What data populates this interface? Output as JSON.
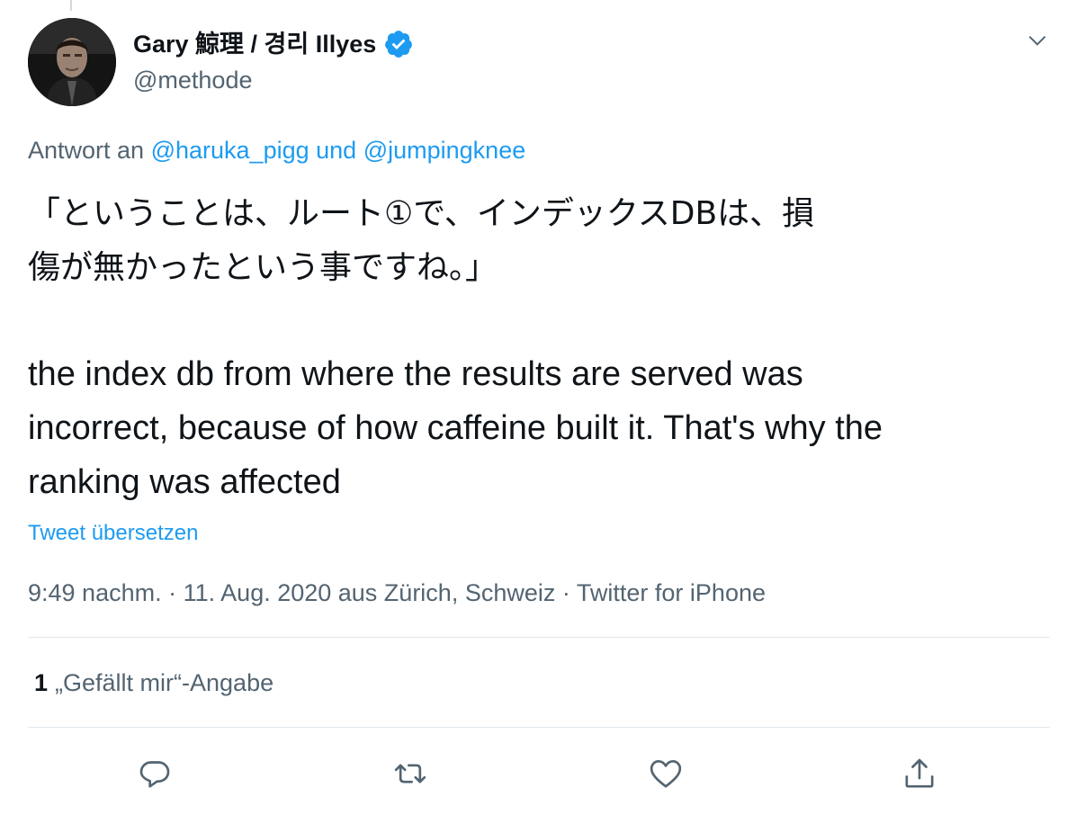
{
  "author": {
    "name": "Gary 鯨理 / 경리 Illyes",
    "handle": "@methode",
    "verified": true
  },
  "reply_to": {
    "prefix": "Antwort an",
    "user1": "@haruka_pigg",
    "joiner": "und",
    "user2": "@jumpingknee"
  },
  "tweet": {
    "text_jp_line1": "「ということは、ルート①で、インデックスDBは、損",
    "text_jp_line2": "傷が無かったという事ですね。」",
    "text_en_line1": "the index db from where the results are served was",
    "text_en_line2": "incorrect, because of how caffeine built it. That's why the",
    "text_en_line3": "ranking was affected",
    "translate_label": "Tweet übersetzen"
  },
  "meta": {
    "time": "9:49 nachm.",
    "date_location": "11. Aug. 2020 aus Zürich, Schweiz",
    "source": "Twitter for iPhone",
    "separator": "·"
  },
  "stats": {
    "likes_count": "1",
    "likes_label": "„Gefällt mir“-Angabe"
  },
  "actions": {
    "icons": [
      "reply-icon",
      "retweet-icon",
      "like-icon",
      "share-icon"
    ]
  },
  "colors": {
    "accent": "#1d9bf0",
    "secondary_text": "#536471",
    "divider": "#e1e8ed"
  }
}
